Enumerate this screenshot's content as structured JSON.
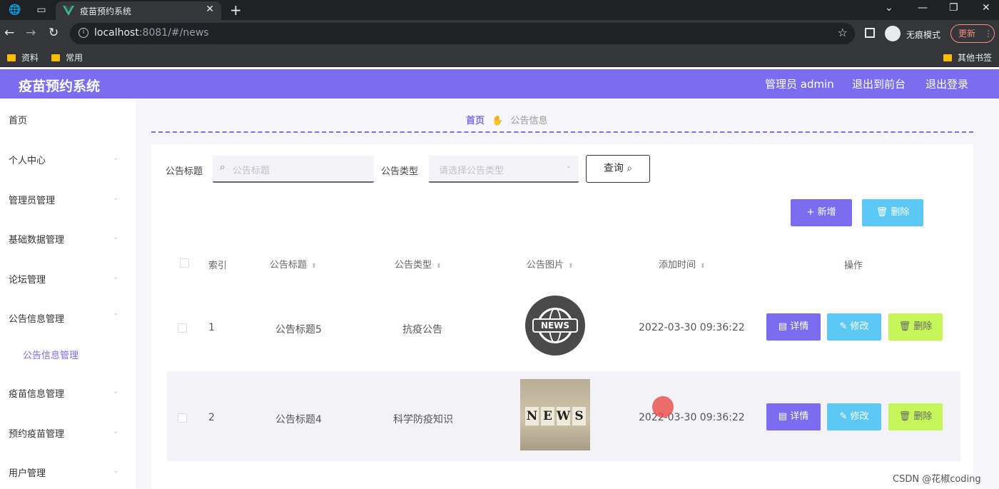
{
  "browser": {
    "tab_title": "疫苗预约系统",
    "url_host": "localhost",
    "url_rest": ":8081/#/news",
    "incognito_label": "无痕模式",
    "update_label": "更新",
    "bookmarks": [
      "资料",
      "常用"
    ],
    "other_bookmarks": "其他书签"
  },
  "header": {
    "app_title": "疫苗预约系统",
    "admin_label": "管理员 admin",
    "to_frontend": "退出到前台",
    "logout": "退出登录"
  },
  "sidebar": {
    "items": [
      "首页",
      "个人中心",
      "管理员管理",
      "基础数据管理",
      "论坛管理",
      "公告信息管理",
      "疫苗信息管理",
      "预约疫苗管理",
      "用户管理"
    ],
    "active_sub": "公告信息管理"
  },
  "breadcrumb": {
    "home": "首页",
    "current": "公告信息"
  },
  "search": {
    "title_label": "公告标题",
    "title_placeholder": "公告标题",
    "type_label": "公告类型",
    "type_placeholder": "请选择公告类型",
    "query_button": "查询"
  },
  "actions": {
    "add": "新增",
    "delete": "删除"
  },
  "table": {
    "headers": {
      "index": "索引",
      "title": "公告标题",
      "type": "公告类型",
      "image": "公告图片",
      "time": "添加时间",
      "ops": "操作"
    },
    "rows": [
      {
        "index": "1",
        "title": "公告标题5",
        "type": "抗疫公告",
        "image_text": "NEWS",
        "time": "2022-03-30 09:36:22"
      },
      {
        "index": "2",
        "title": "公告标题4",
        "type": "科学防疫知识",
        "image_text": "NEWS",
        "time": "2022-03-30 09:36:22"
      }
    ],
    "row_actions": {
      "detail": "详情",
      "edit": "修改",
      "delete": "删除"
    }
  },
  "watermark": "CSDN @花椒coding"
}
